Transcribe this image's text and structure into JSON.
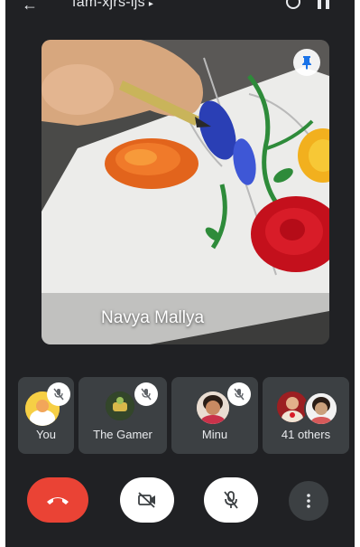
{
  "header": {
    "meeting_code": "fam-xjrs-ijs",
    "back_icon": "arrow-back-icon",
    "switch_camera_icon": "switch-camera-icon",
    "audio_icon": "speaker-icon"
  },
  "main_video": {
    "presenter_name": "Navya Mallya",
    "pin_icon": "pin-icon"
  },
  "participants": [
    {
      "name": "You",
      "muted": true
    },
    {
      "name": "The Gamer",
      "muted": true
    },
    {
      "name": "Minu",
      "muted": true
    },
    {
      "name": "41 others",
      "muted": false
    }
  ],
  "controls": {
    "end_call_icon": "end-call-icon",
    "camera_icon": "camera-off-icon",
    "mic_icon": "mic-off-icon",
    "more_icon": "more-vert-icon"
  },
  "colors": {
    "background": "#202124",
    "tile": "#3c4043",
    "end_call": "#ea4335"
  }
}
